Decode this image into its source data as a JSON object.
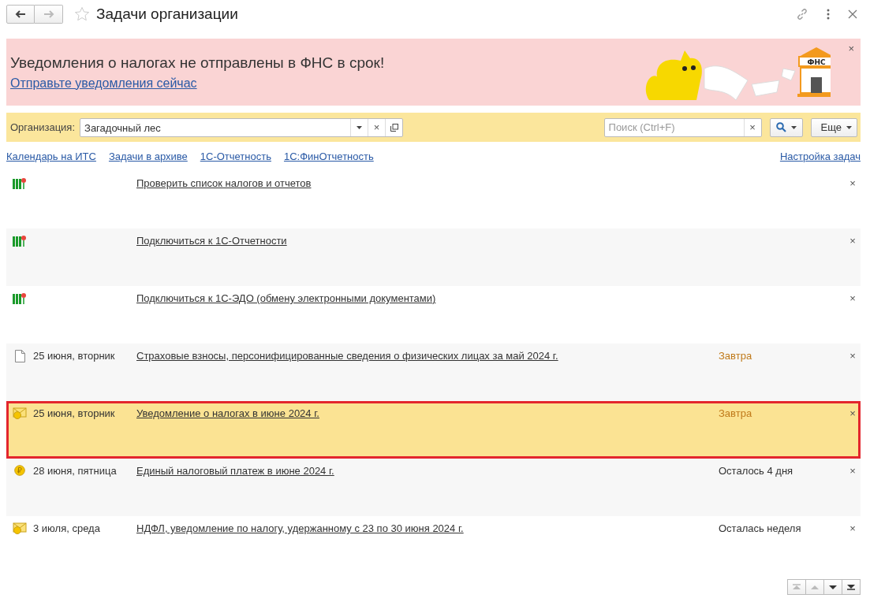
{
  "window": {
    "title": "Задачи организации",
    "nav": [
      {
        "kind": "back",
        "disabled": false
      },
      {
        "kind": "forward",
        "disabled": true
      }
    ],
    "favorite": false
  },
  "banner": {
    "heading": "Уведомления о налогах не отправлены в ФНС в срок!",
    "link": "Отправьте уведомления сейчас",
    "close": "×",
    "art_label": "ФНС"
  },
  "toolbar": {
    "org_label": "Организация:",
    "org_value": "Загадочный лес",
    "clear": "×",
    "search_placeholder": "Поиск (Ctrl+F)",
    "search_clear": "×",
    "more": "Еще"
  },
  "links": [
    "Календарь на ИТС",
    "Задачи в архиве",
    "1С-Отчетность",
    "1С:ФинОтчетность"
  ],
  "settings_link": "Настройка задач",
  "tasks": [
    {
      "kind": "plan",
      "title": "Проверить список налогов и отчетов",
      "selected": false,
      "close": "×"
    },
    {
      "kind": "plan",
      "title": "Подключиться к 1С-Отчетности",
      "selected": false,
      "close": "×"
    },
    {
      "kind": "plan",
      "title": "Подключиться к 1С-ЭДО (обмену электронными документами)",
      "selected": false,
      "close": "×"
    },
    {
      "kind": "document",
      "date": "25 июня, вторник",
      "title": "Страховые взносы, персонифицированные сведения о физических лицах за май 2024 г.",
      "due": "Завтра",
      "urgent": true,
      "selected": false,
      "close": "×"
    },
    {
      "kind": "envelope",
      "date": "25 июня, вторник",
      "title": "Уведомление о налогах в июне 2024 г.",
      "due": "Завтра",
      "urgent": true,
      "selected": true,
      "close": "×"
    },
    {
      "kind": "coin",
      "date": "28 июня, пятница",
      "title": "Единый налоговый платеж в июне 2024 г.",
      "due": "Осталось 4 дня",
      "urgent": false,
      "selected": false,
      "close": "×"
    },
    {
      "kind": "envelope",
      "date": "3 июля, среда",
      "title": "НДФЛ, уведомление по налогу, удержанному с 23 по 30 июня 2024 г.",
      "due": "Осталась неделя",
      "urgent": false,
      "selected": false,
      "close": "×"
    }
  ],
  "pager": [
    {
      "kind": "first",
      "disabled": true
    },
    {
      "kind": "up",
      "disabled": true
    },
    {
      "kind": "down",
      "disabled": false
    },
    {
      "kind": "last",
      "disabled": false
    }
  ]
}
